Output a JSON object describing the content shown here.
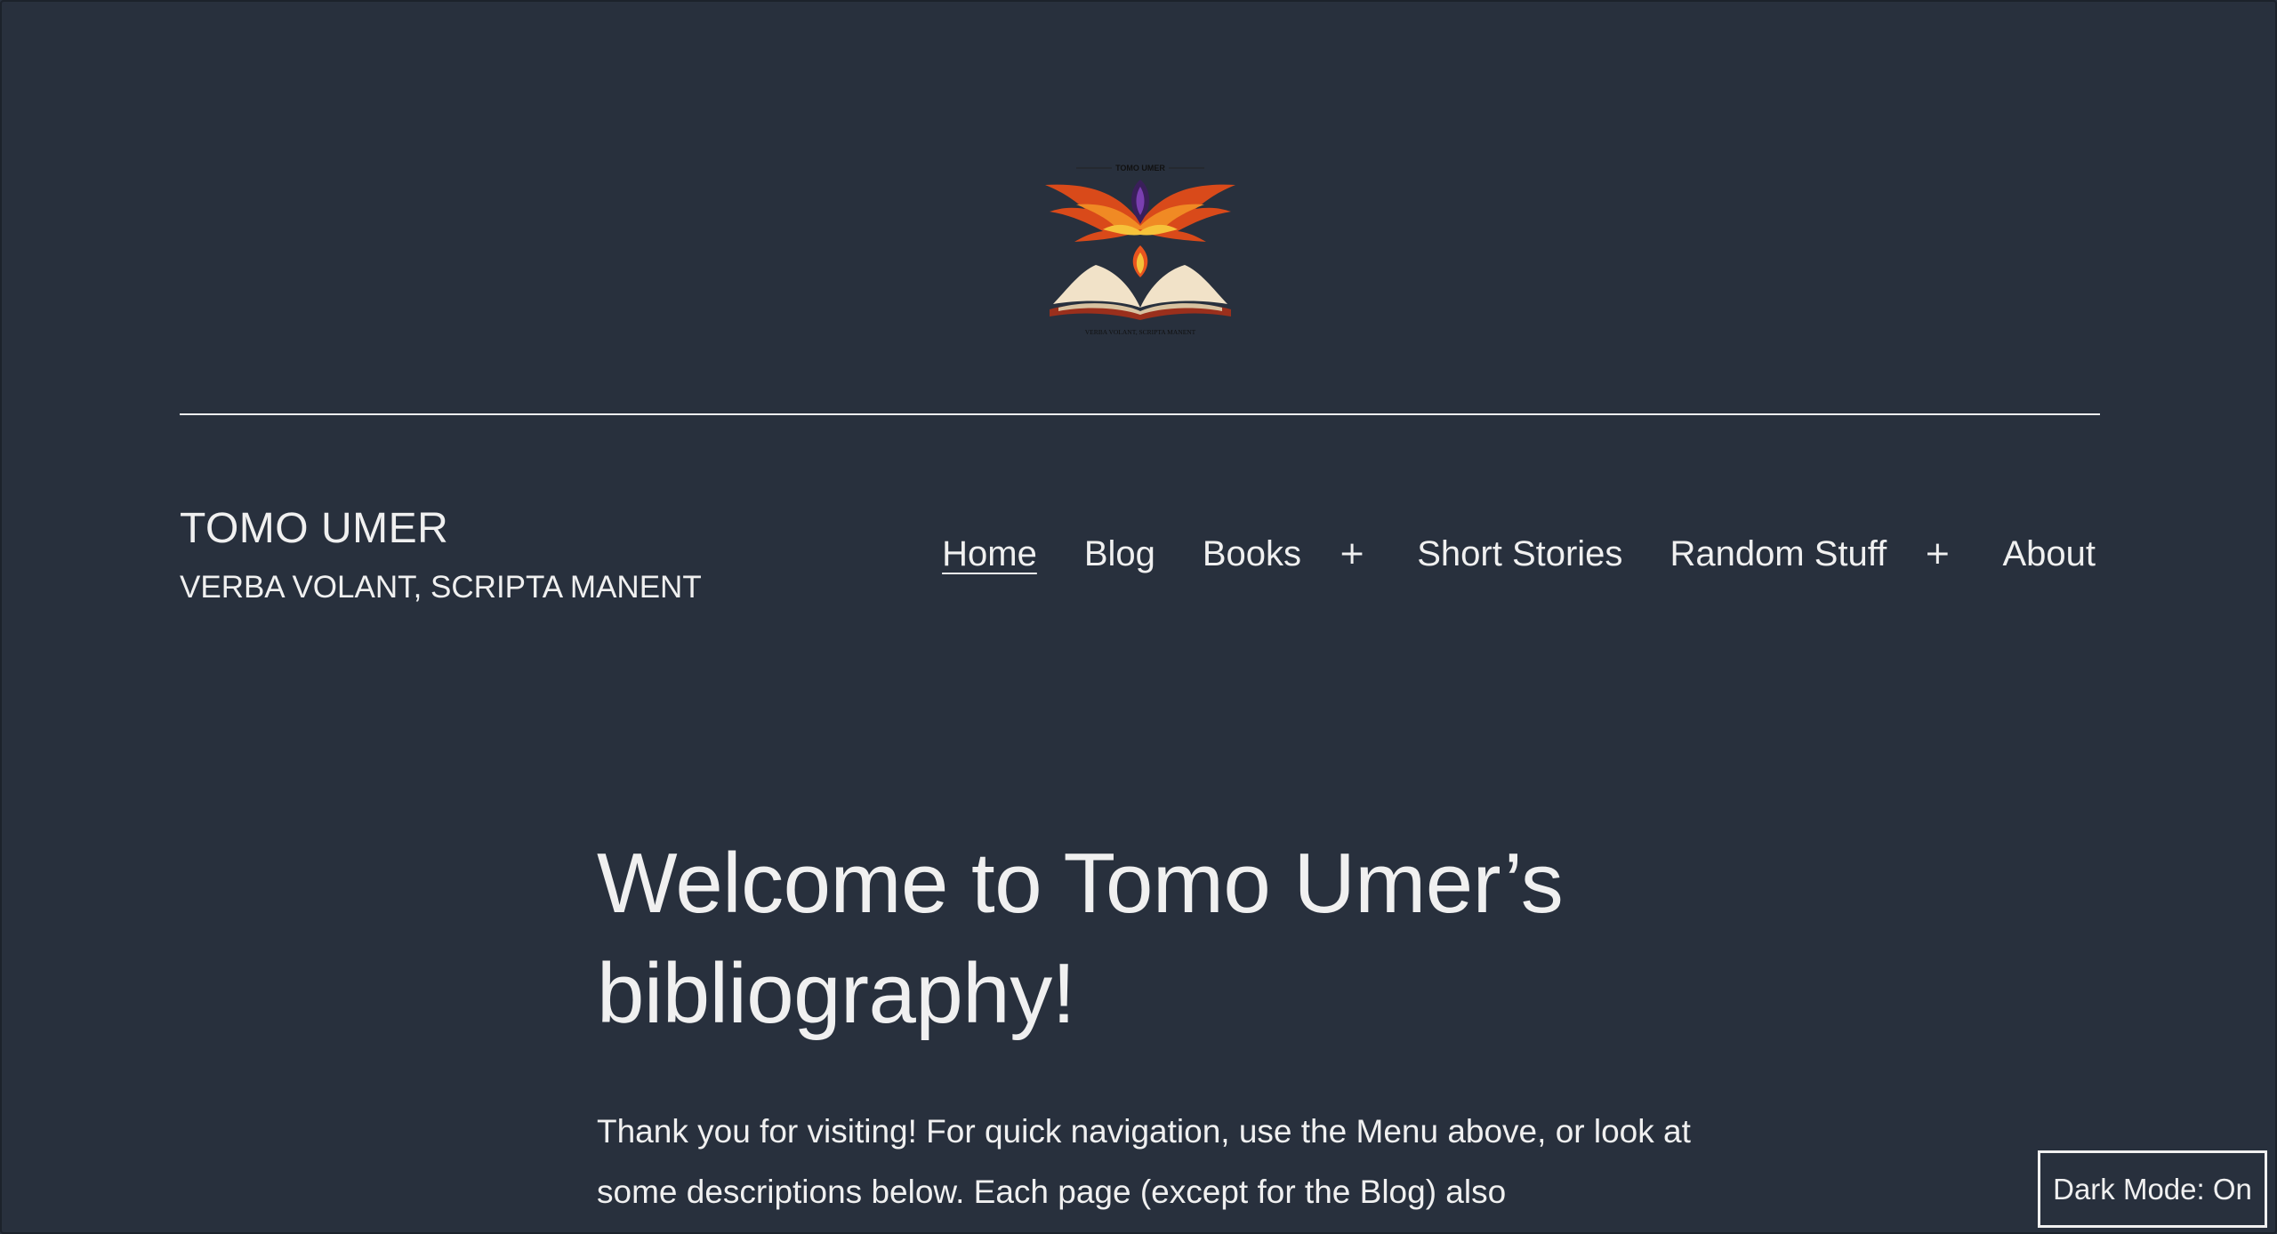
{
  "logo": {
    "top_text": "TOMO UMER",
    "bottom_text": "VERBA VOLANT, SCRIPTA MANENT"
  },
  "site": {
    "title": "TOMO UMER",
    "description": "VERBA VOLANT, SCRIPTA MANENT"
  },
  "nav": {
    "home": "Home",
    "blog": "Blog",
    "books": "Books",
    "books_toggle": "+",
    "short_stories": "Short Stories",
    "random_stuff": "Random Stuff",
    "random_toggle": "+",
    "about": "About"
  },
  "content": {
    "title": "Welcome to Tomo Umer’s bibliography!",
    "intro": "Thank you for visiting! For quick navigation, use the Menu above, or look at some descriptions below. Each page (except for the Blog) also"
  },
  "dark_mode": {
    "label": "Dark Mode: On"
  },
  "colors": {
    "background": "#28303d",
    "text": "#f0f0f0"
  }
}
